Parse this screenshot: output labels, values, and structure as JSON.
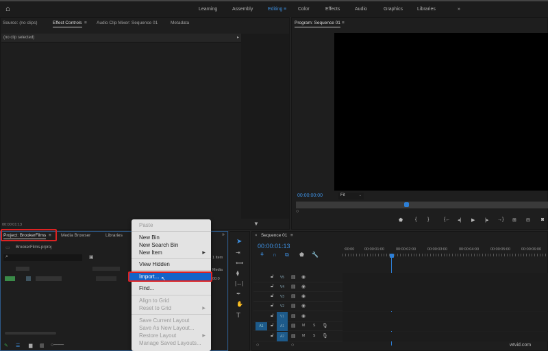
{
  "workspaces": [
    "Learning",
    "Assembly",
    "Editing",
    "Color",
    "Effects",
    "Audio",
    "Graphics",
    "Libraries"
  ],
  "more": "»",
  "source_panel": {
    "tabs": [
      "Source: (no clips)",
      "Effect Controls",
      "Audio Clip Mixer: Sequence 01",
      "Metadata"
    ],
    "no_clip": "(no clip selected)",
    "timecode": "00:00:01:13"
  },
  "program": {
    "title": "Program: Sequence 01",
    "timecode": "00:00:00:00",
    "zoom": "Fit"
  },
  "project": {
    "tabs": [
      "Project: BrookerFilms",
      "Media Browser",
      "Libraries"
    ],
    "file": "BrookerFilms.prproj",
    "items": "1 Item",
    "col": "Media",
    "col2": "00:0"
  },
  "menu": {
    "items": [
      "Paste",
      "New Bin",
      "New Search Bin",
      "New Item",
      "View Hidden",
      "Import...",
      "Find...",
      "Align to Grid",
      "Reset to Grid",
      "Save Current Layout",
      "Save As New Layout...",
      "Restore Layout",
      "Manage Saved Layouts..."
    ]
  },
  "timeline": {
    "title": "Sequence 01",
    "timecode": "00:00:01:13",
    "ruler": [
      ":00:00",
      "00:00:01:00",
      "00:00:02:00",
      "00:00:03:00",
      "00:00:04:00",
      "00:00:05:00",
      "00:00:06:00"
    ],
    "tracks": [
      "V5",
      "V4",
      "V3",
      "V2",
      "V1",
      "A1",
      "A2"
    ],
    "src": "A1",
    "m": "M",
    "s": "S"
  },
  "watermark": "wtvid.com"
}
